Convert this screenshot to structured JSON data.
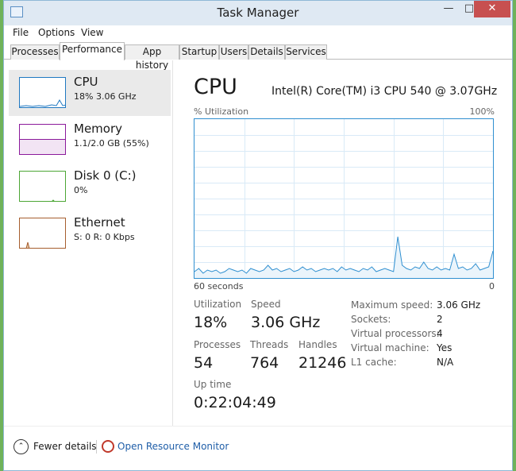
{
  "window": {
    "title": "Task Manager"
  },
  "menu": [
    "File",
    "Options",
    "View"
  ],
  "tabs": [
    {
      "label": "Processes"
    },
    {
      "label": "Performance"
    },
    {
      "label": "App history"
    },
    {
      "label": "Startup"
    },
    {
      "label": "Users"
    },
    {
      "label": "Details"
    },
    {
      "label": "Services"
    }
  ],
  "sidebar": {
    "items": [
      {
        "name": "CPU",
        "sub": "18%  3.06 GHz",
        "color": "#1f78c1"
      },
      {
        "name": "Memory",
        "sub": "1.1/2.0 GB (55%)",
        "color": "#8b1a9b"
      },
      {
        "name": "Disk 0 (C:)",
        "sub": "0%",
        "color": "#4ca635"
      },
      {
        "name": "Ethernet",
        "sub_prefix": "S: 0  R: 0 Kbps",
        "color": "#a65e2e"
      }
    ]
  },
  "main": {
    "title": "CPU",
    "model": "Intel(R) Core(TM) i3 CPU 540 @ 3.07GHz",
    "util_label": "% Utilization",
    "max_label": "100%",
    "time_label": "60 seconds",
    "min_label": "0",
    "stats": {
      "utilization_label": "Utilization",
      "utilization": "18%",
      "speed_label": "Speed",
      "speed": "3.06 GHz",
      "processes_label": "Processes",
      "processes": "54",
      "threads_label": "Threads",
      "threads": "764",
      "handles_label": "Handles",
      "handles": "21246",
      "uptime_label": "Up time",
      "uptime": "0:22:04:49"
    },
    "details": [
      {
        "key": "Maximum speed:",
        "value": "3.06 GHz"
      },
      {
        "key": "Sockets:",
        "value": "2"
      },
      {
        "key": "Virtual processors:",
        "value": "4"
      },
      {
        "key": "Virtual machine:",
        "value": "Yes"
      },
      {
        "key": "L1 cache:",
        "value": "N/A"
      }
    ],
    "cpu_history": [
      4,
      6,
      3,
      5,
      4,
      5,
      3,
      4,
      6,
      5,
      4,
      5,
      3,
      6,
      5,
      4,
      5,
      8,
      5,
      6,
      4,
      5,
      6,
      4,
      5,
      7,
      5,
      6,
      4,
      5,
      6,
      5,
      6,
      4,
      7,
      5,
      6,
      5,
      4,
      6,
      5,
      7,
      4,
      5,
      6,
      5,
      4,
      26,
      8,
      6,
      5,
      7,
      6,
      10,
      6,
      5,
      7,
      5,
      6,
      5,
      15,
      6,
      7,
      5,
      6,
      9,
      5,
      6,
      7,
      17
    ]
  },
  "footer": {
    "fewer_details": "Fewer details",
    "open_resource_monitor": "Open Resource Monitor"
  },
  "colors": {
    "cpu": "#2f8fd0",
    "accent_close": "#c75050"
  }
}
